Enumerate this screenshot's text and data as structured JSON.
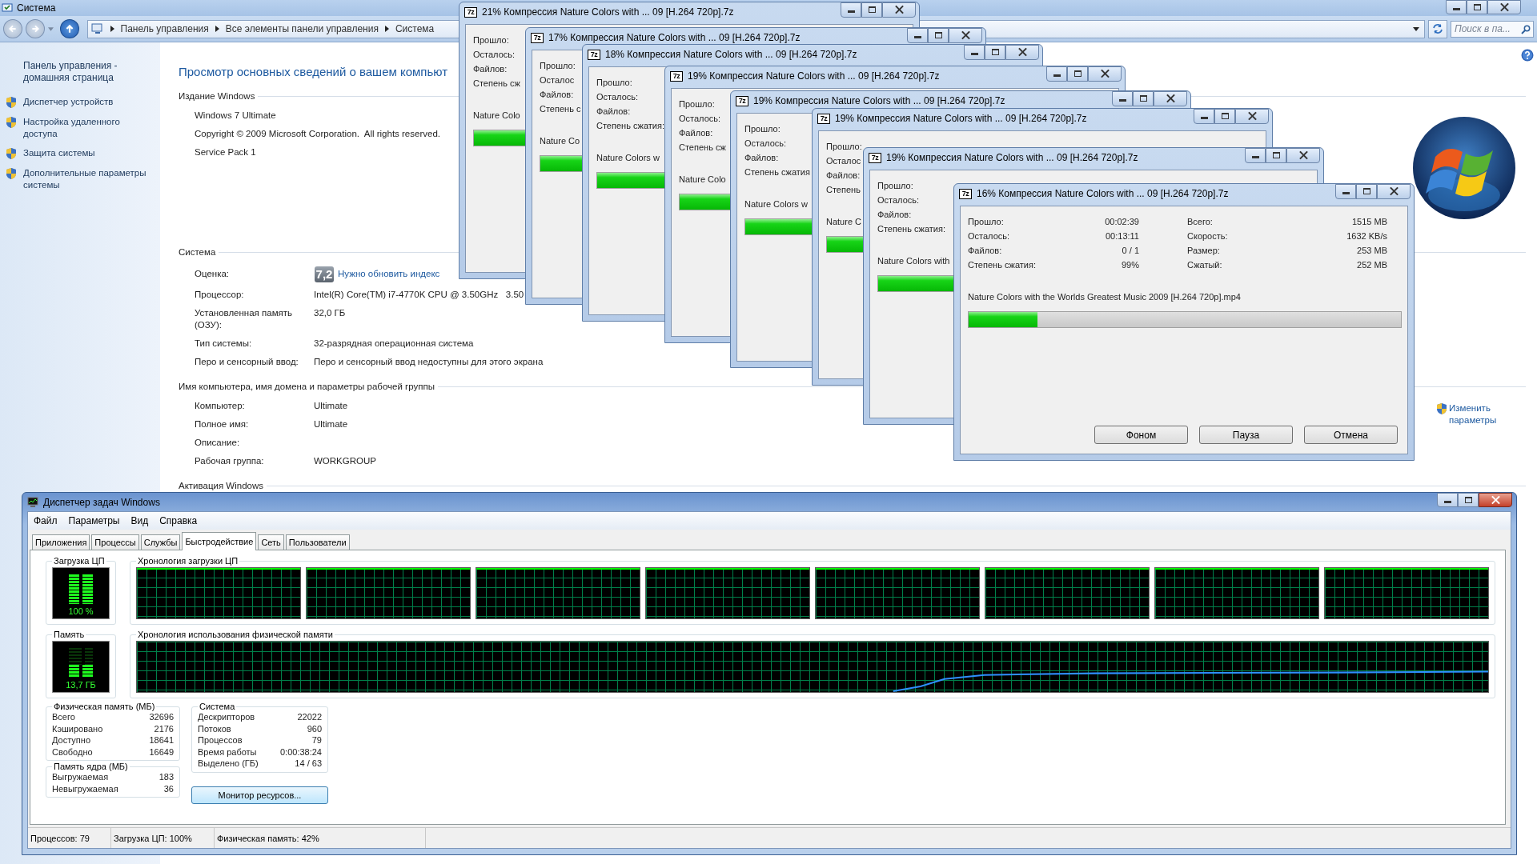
{
  "control_panel": {
    "title": "Система",
    "breadcrumb": [
      "Панель управления",
      "Все элементы панели управления",
      "Система"
    ],
    "search": {
      "placeholder": "Поиск в па..."
    },
    "sidebar": {
      "home": "Панель управления - домашняя страница",
      "links": [
        "Диспетчер устройств",
        "Настройка удаленного доступа",
        "Защита системы",
        "Дополнительные параметры системы"
      ]
    },
    "heading": "Просмотр основных сведений о вашем компьют",
    "sections": [
      {
        "title": "Издание Windows",
        "rows": [
          {
            "value": "Windows 7 Ultimate"
          },
          {
            "value": "Copyright © 2009 Microsoft Corporation.  All rights reserved."
          },
          {
            "value": "Service Pack 1"
          }
        ]
      },
      {
        "title": "Система",
        "rows": [
          {
            "kind": "rating",
            "label": "Оценка:",
            "badge": "7,2",
            "value": "Нужно обновить индекс"
          },
          {
            "label": "Процессор:",
            "value": "Intel(R) Core(TM) i7-4770K CPU @ 3.50GHz   3.50"
          },
          {
            "label": "Установленная память (ОЗУ):",
            "value": "32,0 ГБ"
          },
          {
            "label": "Тип системы:",
            "value": "32-разрядная операционная система"
          },
          {
            "label": "Перо и сенсорный ввод:",
            "value": "Перо и сенсорный ввод недоступны для этого экрана"
          }
        ]
      },
      {
        "title": "Имя компьютера, имя домена и параметры рабочей группы",
        "link": "Изменить параметры",
        "rows": [
          {
            "label": "Компьютер:",
            "value": "Ultimate"
          },
          {
            "label": "Полное имя:",
            "value": "Ultimate"
          },
          {
            "label": "Описание:"
          },
          {
            "label": "Рабочая группа:",
            "value": "WORKGROUP"
          }
        ]
      },
      {
        "title": "Активация Windows"
      }
    ]
  },
  "archive_windows": [
    {
      "icon": "7z",
      "title": "21% Компрессия Nature Colors with ... 09 [H.264 720p].7z",
      "labels": [
        "Прошло:",
        "Осталось:",
        "Файлов:",
        "Степень сж"
      ],
      "file": "Nature Colo",
      "level": 0.21
    },
    {
      "icon": "7z",
      "title": "17% Компрессия Nature Colors with ... 09 [H.264 720p].7z",
      "labels": [
        "Прошло:",
        "Осталос",
        "Файлов:",
        "Степень с"
      ],
      "file": "Nature Co",
      "level": 0.17
    },
    {
      "icon": "7z",
      "title": "18% Компрессия Nature Colors with ... 09 [H.264 720p].7z",
      "labels": [
        "Прошло:",
        "Осталось:",
        "Файлов:",
        "Степень сжатия:"
      ],
      "file": "Nature Colors w",
      "level": 0.18
    },
    {
      "icon": "7z",
      "title": "19% Компрессия Nature Colors with ... 09 [H.264 720p].7z",
      "labels": [
        "Прошло:",
        "Осталось:",
        "Файлов:",
        "Степень сж"
      ],
      "file": "Nature Colo",
      "level": 0.19
    },
    {
      "icon": "7z",
      "title": "19% Компрессия Nature Colors with ... 09 [H.264 720p].7z",
      "labels": [
        "Прошло:",
        "Осталось:",
        "Файлов:",
        "Степень сжатия"
      ],
      "file": "Nature Colors w",
      "level": 0.19
    },
    {
      "icon": "7z",
      "title": "19% Компрессия Nature Colors with ... 09 [H.264 720p].7z",
      "labels": [
        "Прошло:",
        "Осталос",
        "Файлов:",
        "Степень"
      ],
      "file": "Nature C",
      "level": 0.19
    },
    {
      "icon": "7z",
      "title": "19% Компрессия Nature Colors with ... 09 [H.264 720p].7z",
      "labels": [
        "Прошло:",
        "Осталось:",
        "Файлов:",
        "Степень сжатия:"
      ],
      "file": "Nature Colors with",
      "level": 0.19
    },
    {
      "icon": "7z",
      "title": "16% Компрессия Nature Colors with ... 09 [H.264 720p].7z",
      "stats": [
        {
          "rows": [
            {
              "label": "Прошло:",
              "value": "00:02:39"
            },
            {
              "label": "Осталось:",
              "value": "00:13:11"
            },
            {
              "label": "Файлов:",
              "value": "0 / 1"
            },
            {
              "label": "Степень сжатия:",
              "value": "99%"
            }
          ]
        },
        {
          "rows": [
            {
              "label": "Всего:",
              "value": "1515 MB"
            },
            {
              "label": "Скорость:",
              "value": "1632 KB/s"
            },
            {
              "label": "Размер:",
              "value": "253 MB"
            },
            {
              "label": "Сжатый:",
              "value": "252 MB"
            }
          ]
        }
      ],
      "file": "Nature Colors with the Worlds Greatest Music 2009 [H.264 720p].mp4",
      "level": 0.16,
      "buttons": [
        "Фоном",
        "Пауза",
        "Отмена"
      ]
    }
  ],
  "task_manager": {
    "title": "Диспетчер задач Windows",
    "menu": [
      "Файл",
      "Параметры",
      "Вид",
      "Справка"
    ],
    "tabs": [
      {
        "label": "Приложения",
        "selected": false
      },
      {
        "label": "Процессы",
        "selected": false
      },
      {
        "label": "Службы",
        "selected": false
      },
      {
        "label": "Быстродействие",
        "selected": true
      },
      {
        "label": "Сеть",
        "selected": false
      },
      {
        "label": "Пользователи",
        "selected": false
      }
    ],
    "cpu": {
      "title": "Загрузка ЦП",
      "reading": "100 %",
      "level": 1
    },
    "cpu_history": {
      "title": "Хронология загрузки ЦП",
      "cores": [
        {
          "level": 1
        },
        {
          "level": 1
        },
        {
          "level": 1
        },
        {
          "level": 1
        },
        {
          "level": 1
        },
        {
          "level": 1
        },
        {
          "level": 1
        },
        {
          "level": 1
        }
      ]
    },
    "memory": {
      "title": "Память",
      "reading": "13,7 ГБ",
      "level": 0.42
    },
    "memory_history": {
      "title": "Хронология использования физической памяти"
    },
    "groups": [
      {
        "title": "Физическая память (МБ)",
        "rows": [
          {
            "label": "Всего",
            "value": "32696"
          },
          {
            "label": "Кэшировано",
            "value": "2176"
          },
          {
            "label": "Доступно",
            "value": "18641"
          },
          {
            "label": "Свободно",
            "value": "16649"
          }
        ]
      },
      {
        "title": "Память ядра (МБ)",
        "rows": [
          {
            "label": "Выгружаемая",
            "value": "183"
          },
          {
            "label": "Невыгружаемая",
            "value": "36"
          }
        ]
      },
      {
        "title": "Система",
        "rows": [
          {
            "label": "Дескрипторов",
            "value": "22022"
          },
          {
            "label": "Потоков",
            "value": "960"
          },
          {
            "label": "Процессов",
            "value": "79"
          },
          {
            "label": "Время работы",
            "value": "0:00:38:24"
          },
          {
            "label": "Выделено (ГБ)",
            "value": "14 / 63"
          }
        ]
      }
    ],
    "resource_button": "Монитор ресурсов...",
    "status_bar": [
      "Процессов: 79",
      "Загрузка ЦП: 100%",
      "Физическая память: 42%"
    ]
  }
}
